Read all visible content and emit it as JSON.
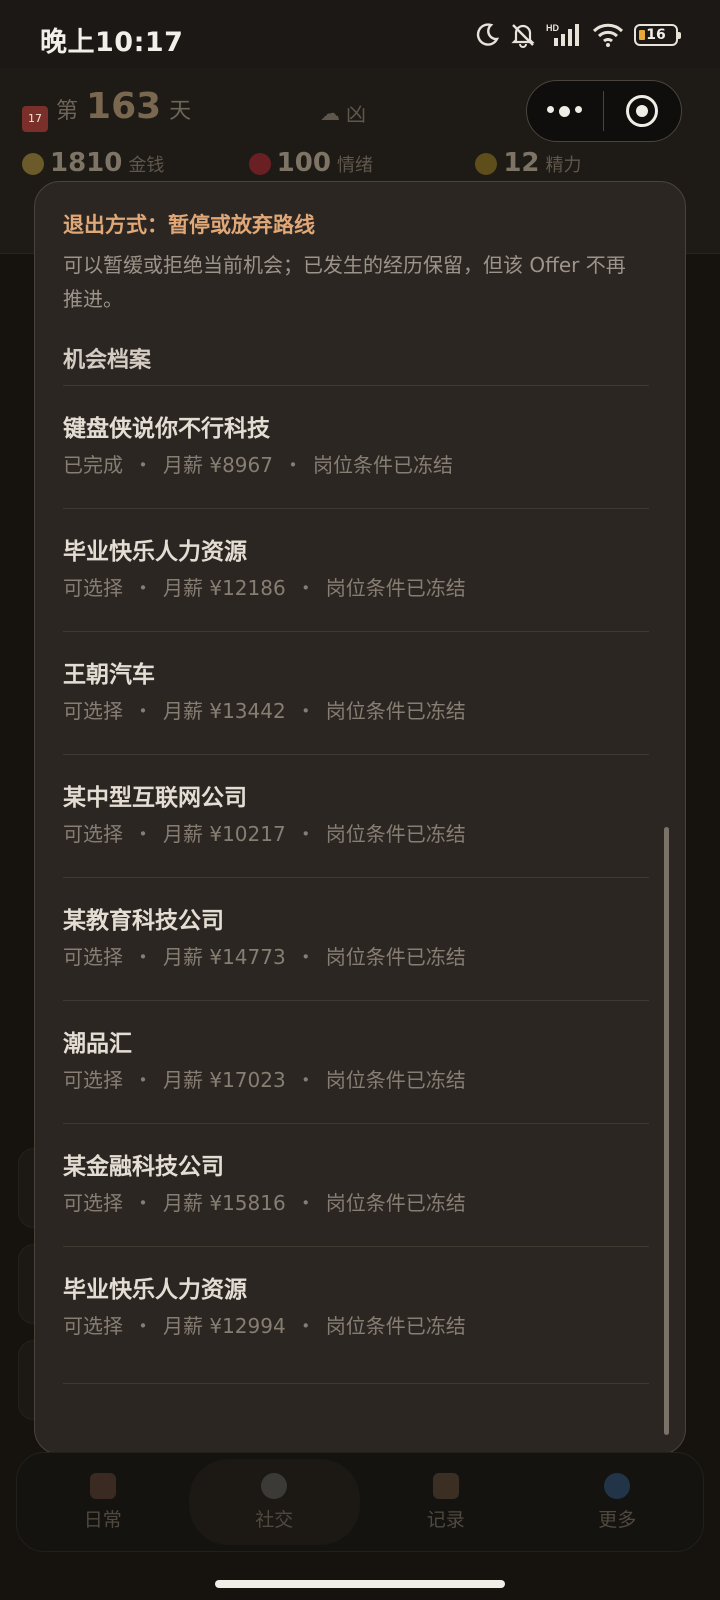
{
  "status_bar": {
    "time": "晚上10:17",
    "battery_level": "16",
    "icons": [
      "moon-icon",
      "bell-off-icon",
      "hd-signal-icon",
      "wifi-icon",
      "battery-icon"
    ]
  },
  "background": {
    "day_prefix": "第",
    "day_number": "163",
    "day_suffix": "天",
    "weather": "凶",
    "stats": [
      {
        "value": "1810",
        "label": "金钱",
        "icon": "money-bag-icon"
      },
      {
        "value": "100",
        "label": "情绪",
        "icon": "heart-icon"
      },
      {
        "value": "12",
        "label": "精力",
        "icon": "lightning-icon"
      }
    ]
  },
  "capsule": {
    "more": "more-icon",
    "close": "close-miniprogram-icon"
  },
  "sheet": {
    "exit_title": "退出方式：暂停或放弃路线",
    "exit_description": "可以暂缓或拒绝当前机会；已发生的经历保留，但该 Offer 不再推进。",
    "section_title": "机会档案",
    "offers": [
      {
        "company": "键盘侠说你不行科技",
        "status": "已完成",
        "salary": "月薪 ¥8967",
        "condition": "岗位条件已冻结"
      },
      {
        "company": "毕业快乐人力资源",
        "status": "可选择",
        "salary": "月薪 ¥12186",
        "condition": "岗位条件已冻结"
      },
      {
        "company": "王朝汽车",
        "status": "可选择",
        "salary": "月薪 ¥13442",
        "condition": "岗位条件已冻结"
      },
      {
        "company": "某中型互联网公司",
        "status": "可选择",
        "salary": "月薪 ¥10217",
        "condition": "岗位条件已冻结"
      },
      {
        "company": "某教育科技公司",
        "status": "可选择",
        "salary": "月薪 ¥14773",
        "condition": "岗位条件已冻结"
      },
      {
        "company": "潮品汇",
        "status": "可选择",
        "salary": "月薪 ¥17023",
        "condition": "岗位条件已冻结"
      },
      {
        "company": "某金融科技公司",
        "status": "可选择",
        "salary": "月薪 ¥15816",
        "condition": "岗位条件已冻结"
      },
      {
        "company": "毕业快乐人力资源",
        "status": "可选择",
        "salary": "月薪 ¥12994",
        "condition": "岗位条件已冻结"
      }
    ],
    "separator": "・"
  },
  "nav": {
    "items": [
      {
        "label": "日常",
        "icon": "home-icon"
      },
      {
        "label": "社交",
        "icon": "chat-icon"
      },
      {
        "label": "记录",
        "icon": "scroll-icon"
      },
      {
        "label": "更多",
        "icon": "gear-icon"
      }
    ],
    "active_index": 1
  }
}
